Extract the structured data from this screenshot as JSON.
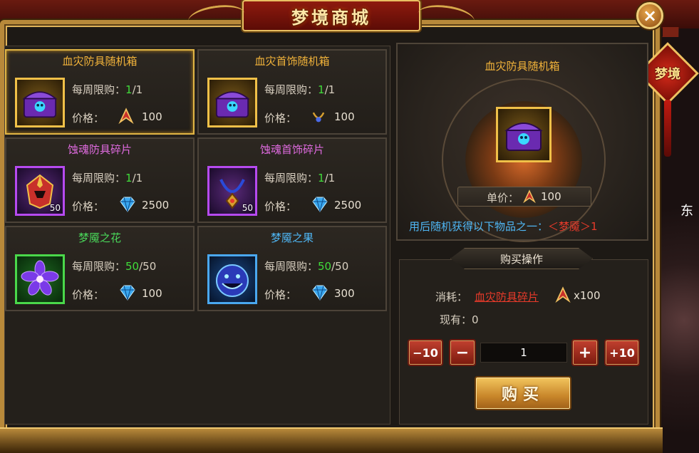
{
  "title": "梦境商城",
  "close_label": "×",
  "side_tab": {
    "label": "梦境"
  },
  "side_text": "东",
  "items": [
    {
      "name": "血灾防具随机箱",
      "name_color": "gold",
      "limit_label": "每周限购：",
      "limit_current": "1",
      "limit_total": "/1",
      "price_label": "价格：",
      "currency_icon": "blood-shard-icon",
      "price": "100",
      "icon": "purple-chest-icon",
      "count": "",
      "selected": true
    },
    {
      "name": "血灾首饰随机箱",
      "name_color": "gold",
      "limit_label": "每周限购：",
      "limit_current": "1",
      "limit_total": "/1",
      "price_label": "价格：",
      "currency_icon": "jewel-shard-icon",
      "price": "100",
      "icon": "purple-chest-icon",
      "count": "",
      "selected": false
    },
    {
      "name": "蚀魂防具碎片",
      "name_color": "pink",
      "limit_label": "每周限购：",
      "limit_current": "1",
      "limit_total": "/1",
      "price_label": "价格：",
      "currency_icon": "diamond-icon",
      "price": "2500",
      "icon": "helmet-shard-icon",
      "count": "50",
      "selected": false
    },
    {
      "name": "蚀魂首饰碎片",
      "name_color": "pink",
      "limit_label": "每周限购：",
      "limit_current": "1",
      "limit_total": "/1",
      "price_label": "价格：",
      "currency_icon": "diamond-icon",
      "price": "2500",
      "icon": "necklace-shard-icon",
      "count": "50",
      "selected": false
    },
    {
      "name": "梦魇之花",
      "name_color": "green",
      "limit_label": "每周限购：",
      "limit_current": "50",
      "limit_total": "/50",
      "price_label": "价格：",
      "currency_icon": "diamond-icon",
      "price": "100",
      "icon": "flower-icon",
      "count": "",
      "selected": false
    },
    {
      "name": "梦魇之果",
      "name_color": "blue",
      "limit_label": "每周限购：",
      "limit_current": "50",
      "limit_total": "/50",
      "price_label": "价格：",
      "currency_icon": "diamond-icon",
      "price": "300",
      "icon": "fruit-icon",
      "count": "",
      "selected": false
    }
  ],
  "detail": {
    "name": "血灾防具随机箱",
    "unit_label": "单价：",
    "unit_price": "100",
    "desc_prefix": "用后随机获得以下物品之一：",
    "desc_link": "＜梦魇＞1"
  },
  "operation": {
    "title": "购买操作",
    "cost_label": "消耗：",
    "cost_item": "血灾防具碎片",
    "cost_qty": "x100",
    "own_label": "现有：0",
    "minus10": "−10",
    "minus": "−",
    "quantity": "1",
    "plus": "+",
    "plus10": "+10",
    "buy": "购买"
  },
  "colors": {
    "gold": "#f2b33a",
    "pink": "#e06be0",
    "green": "#4ad85a",
    "blue": "#4fb7f5",
    "link_red": "#e83a2a",
    "limit_green": "#40dc3a"
  }
}
